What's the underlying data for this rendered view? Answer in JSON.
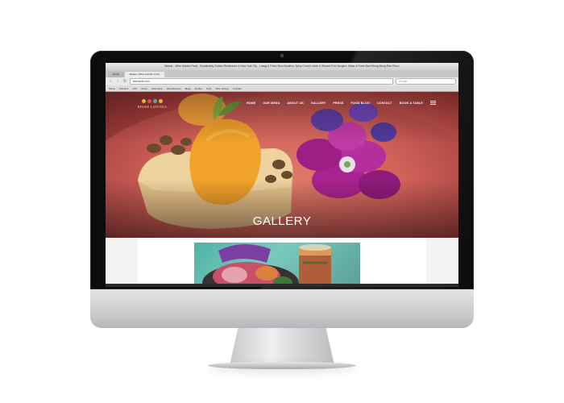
{
  "browser": {
    "window_title": "Bessie - Wine Garden Food - Sustainably Cuisine Restaurant in New York City - Lasag & Fresh Slow Noodles, Spicy Crunch Lamb & Stewed Pork Burgers, Salsa & Fresh Beef Mung Mung Rice Ricco",
    "tabs": [
      {
        "label": "Home"
      },
      {
        "label": "Bessie | Wine Garden Food"
      }
    ],
    "url": "wanfoods.com",
    "search_placeholder": "Google",
    "bookmarks": [
      "Studio",
      "Teachers",
      "CSS",
      "Vimeo",
      "Information",
      "Miscellaneous",
      "Blogs",
      "Archive",
      "Tools",
      "Wine Society",
      "Tutorials"
    ]
  },
  "site": {
    "logo_text": "BESSIE LATENDA",
    "nav": [
      "HOME",
      "OUR MENU",
      "ABOUT US",
      "GALLERY",
      "PRESS",
      "FOOD BLOG",
      "CONTACT",
      "BOOK A TABLE"
    ],
    "hero_title": "GALLERY"
  },
  "colors": {
    "hero_accent": "#c9574f",
    "flower": "#a8238f",
    "nav_text": "#ffffff"
  }
}
